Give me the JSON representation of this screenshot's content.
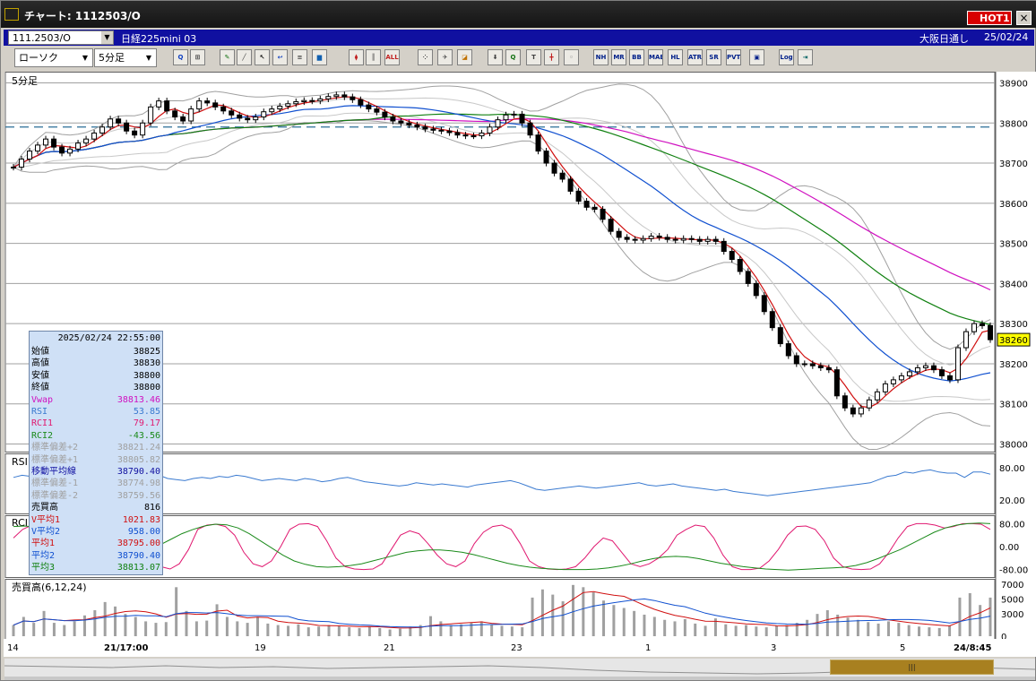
{
  "window": {
    "title": "チャート: 1112503/O",
    "hot_label": "HOT1",
    "close_label": "×"
  },
  "info": {
    "symbol": "111.2503/O",
    "symbol_name": "日経225mini 03",
    "market": "大阪日通し",
    "date": "25/02/24"
  },
  "toolbar": {
    "chart_type": "ローソク",
    "interval": "5分足",
    "tools": [
      {
        "icon": "magnifier-icon",
        "text": "Q",
        "color": "#1040c0"
      },
      {
        "icon": "split-panes-icon",
        "text": "⊞",
        "color": "#404040"
      },
      {
        "icon": "pencil-icon",
        "text": "✎",
        "color": "#107010"
      },
      {
        "icon": "draw-line-icon",
        "text": "╱",
        "color": "#404040"
      },
      {
        "icon": "cursor-icon",
        "text": "↖",
        "color": "#000000"
      },
      {
        "icon": "undo-icon",
        "text": "↩",
        "color": "#1040c0"
      },
      {
        "icon": "list-icon",
        "text": "≡",
        "color": "#404040"
      },
      {
        "icon": "trash-icon",
        "text": "▆",
        "color": "#1060b0"
      },
      {
        "icon": "candle-icon",
        "text": "⧫",
        "color": "#c02020"
      },
      {
        "icon": "bars-icon",
        "text": "║",
        "color": "#404040"
      },
      {
        "icon": "all-icon",
        "text": "ALL",
        "color": "#c02020"
      },
      {
        "icon": "dots-icon",
        "text": "⁘",
        "color": "#404040"
      },
      {
        "icon": "wrench-icon",
        "text": "✈",
        "color": "#404040"
      },
      {
        "icon": "color-icon",
        "text": "◪",
        "color": "#c07000"
      },
      {
        "icon": "arrow-down-icon",
        "text": "⬇",
        "color": "#404040"
      },
      {
        "icon": "zoom-icon",
        "text": "Q",
        "color": "#107010"
      },
      {
        "icon": "text-box-icon",
        "text": "T",
        "color": "#404040"
      },
      {
        "icon": "crosshair-icon",
        "text": "╋",
        "color": "#c02020"
      },
      {
        "icon": "lock-icon",
        "text": "◦",
        "color": "#808080"
      },
      {
        "icon": "indicator-nh-icon",
        "text": "NH",
        "color": "#00208a"
      },
      {
        "icon": "indicator-mr-icon",
        "text": "MR",
        "color": "#00208a"
      },
      {
        "icon": "indicator-bb-icon",
        "text": "BB",
        "color": "#00208a"
      },
      {
        "icon": "indicator-mae-icon",
        "text": "MAE",
        "color": "#00208a"
      },
      {
        "icon": "indicator-hl-icon",
        "text": "HL",
        "color": "#00208a"
      },
      {
        "icon": "indicator-atr-icon",
        "text": "ATR",
        "color": "#00208a"
      },
      {
        "icon": "indicator-sr-icon",
        "text": "SR",
        "color": "#00208a"
      },
      {
        "icon": "indicator-pvt-icon",
        "text": "PVT",
        "color": "#00208a"
      },
      {
        "icon": "frame-icon",
        "text": "▣",
        "color": "#00208a"
      },
      {
        "icon": "log-icon",
        "text": "Log",
        "color": "#00208a"
      },
      {
        "icon": "export-icon",
        "text": "⇥",
        "color": "#006060"
      }
    ]
  },
  "chart": {
    "panel_label": "5分足",
    "price_axis": [
      "38900",
      "38800",
      "38700",
      "38600",
      "38500",
      "38400",
      "38300",
      "38200",
      "38100",
      "38000"
    ],
    "last_price": "38260",
    "dashed_level": 38790,
    "rsi_label": "RSI",
    "rsi_axis": [
      "80.00",
      "20.00"
    ],
    "rci_label": "RCI",
    "rci_axis": [
      "80.00",
      "0.00",
      "-80.00"
    ],
    "volume_label": "売買高(6,12,24)",
    "volume_axis": [
      "7000",
      "5000",
      "3000",
      "0"
    ],
    "time_axis": [
      "14",
      "21/17:00",
      "19",
      "21",
      "23",
      "1",
      "3",
      "5",
      "24/8:45"
    ],
    "colors": {
      "up": "#ffffff",
      "down": "#000000",
      "ma_short": "#d01010",
      "ma_mid": "#1050d0",
      "ma_long": "#108010",
      "ma_vwap": "#d010c0",
      "band": "#a0a0a0",
      "dashed": "#2a6f98",
      "rsi": "#3a7ad0",
      "rci1": "#e01870",
      "rci2": "#1a8a1a"
    }
  },
  "chart_data": {
    "type": "candlestick",
    "ylim": [
      37990,
      38910
    ],
    "close": [
      38690,
      38710,
      38730,
      38745,
      38760,
      38740,
      38725,
      38735,
      38750,
      38760,
      38775,
      38790,
      38810,
      38800,
      38780,
      38770,
      38800,
      38840,
      38855,
      38830,
      38815,
      38805,
      38835,
      38855,
      38850,
      38840,
      38830,
      38820,
      38812,
      38808,
      38815,
      38828,
      38835,
      38842,
      38848,
      38853,
      38856,
      38855,
      38860,
      38866,
      38870,
      38865,
      38858,
      38845,
      38835,
      38827,
      38815,
      38805,
      38800,
      38795,
      38790,
      38785,
      38782,
      38780,
      38776,
      38770,
      38768,
      38768,
      38775,
      38790,
      38808,
      38820,
      38822,
      38800,
      38770,
      38730,
      38700,
      38675,
      38660,
      38630,
      38605,
      38590,
      38585,
      38560,
      38530,
      38515,
      38510,
      38508,
      38512,
      38518,
      38515,
      38510,
      38508,
      38512,
      38510,
      38505,
      38510,
      38505,
      38480,
      38460,
      38430,
      38400,
      38370,
      38330,
      38290,
      38250,
      38220,
      38200,
      38200,
      38195,
      38190,
      38185,
      38120,
      38090,
      38075,
      38090,
      38110,
      38130,
      38150,
      38160,
      38170,
      38180,
      38190,
      38195,
      38185,
      38170,
      38160,
      38240,
      38280,
      38300,
      38295,
      38260
    ],
    "rsi": [
      62,
      66,
      64,
      70,
      68,
      60,
      62,
      58,
      60,
      64,
      66,
      62,
      64,
      66,
      62,
      68,
      70,
      66,
      60,
      58,
      56,
      60,
      62,
      60,
      64,
      62,
      66,
      64,
      60,
      56,
      58,
      60,
      58,
      56,
      60,
      58,
      54,
      56,
      60,
      62,
      58,
      54,
      52,
      50,
      48,
      46,
      48,
      52,
      50,
      48,
      50,
      48,
      46,
      44,
      48,
      50,
      52,
      54,
      56,
      52,
      46,
      40,
      38,
      40,
      42,
      44,
      46,
      44,
      42,
      44,
      46,
      48,
      50,
      52,
      48,
      46,
      48,
      50,
      46,
      44,
      42,
      40,
      38,
      40,
      36,
      34,
      32,
      30,
      28,
      30,
      32,
      34,
      36,
      38,
      40,
      42,
      44,
      46,
      48,
      50,
      52,
      58,
      64,
      66,
      72,
      70,
      74,
      76,
      72,
      70,
      70,
      62,
      72,
      72,
      68
    ],
    "rci1": [
      30,
      60,
      75,
      80,
      50,
      0,
      -60,
      -75,
      -70,
      -40,
      0,
      55,
      75,
      70,
      40,
      -30,
      -70,
      -78,
      -60,
      -10,
      60,
      75,
      78,
      70,
      40,
      -20,
      -60,
      -70,
      -50,
      0,
      60,
      78,
      80,
      70,
      20,
      -40,
      -70,
      -78,
      -80,
      -78,
      -60,
      -10,
      40,
      55,
      45,
      10,
      -30,
      -60,
      -70,
      -50,
      10,
      50,
      70,
      75,
      60,
      10,
      -50,
      -70,
      -78,
      -80,
      -78,
      -70,
      -40,
      0,
      30,
      20,
      -20,
      -60,
      -70,
      -60,
      -40,
      -10,
      40,
      60,
      75,
      70,
      30,
      -30,
      -70,
      -80,
      -80,
      -75,
      -50,
      -10,
      40,
      70,
      72,
      60,
      20,
      -40,
      -70,
      -78,
      -80,
      -78,
      -60,
      -20,
      30,
      70,
      80,
      80,
      75,
      65,
      70,
      80,
      80,
      78,
      60
    ],
    "rci2": [
      70,
      72,
      68,
      60,
      45,
      25,
      10,
      -5,
      -20,
      -30,
      -35,
      -30,
      -15,
      5,
      25,
      45,
      60,
      72,
      78,
      76,
      65,
      45,
      20,
      -5,
      -30,
      -50,
      -62,
      -70,
      -72,
      -70,
      -66,
      -60,
      -50,
      -40,
      -30,
      -20,
      -15,
      -12,
      -12,
      -15,
      -20,
      -28,
      -38,
      -48,
      -58,
      -66,
      -72,
      -76,
      -78,
      -80,
      -80,
      -80,
      -78,
      -74,
      -68,
      -60,
      -50,
      -42,
      -36,
      -34,
      -36,
      -42,
      -50,
      -58,
      -64,
      -70,
      -74,
      -78,
      -80,
      -82,
      -80,
      -78,
      -76,
      -74,
      -72,
      -66,
      -56,
      -42,
      -26,
      -10,
      10,
      30,
      50,
      65,
      75,
      80,
      82,
      80
    ],
    "volume": [
      1500,
      2600,
      1800,
      3400,
      1800,
      1500,
      2000,
      2800,
      3500,
      4600,
      4000,
      3000,
      2600,
      2000,
      1800,
      1900,
      6600,
      3400,
      2000,
      2100,
      4300,
      2600,
      2000,
      1800,
      2600,
      1700,
      1500,
      1400,
      1600,
      1200,
      1300,
      1500,
      1400,
      1200,
      1100,
      1300,
      1100,
      900,
      1000,
      1300,
      1500,
      2700,
      2000,
      1500,
      1600,
      1800,
      2000,
      1500,
      1400,
      1300,
      1200,
      5200,
      6300,
      5600,
      4700,
      6900,
      6600,
      5900,
      4800,
      4200,
      3800,
      3400,
      2900,
      2600,
      2200,
      2000,
      2300,
      1700,
      1400,
      2400,
      1600,
      1400,
      1500,
      1300,
      1200,
      1400,
      1500,
      1800,
      2200,
      3000,
      3500,
      2900,
      2500,
      2200,
      1900,
      1700,
      2000,
      1800,
      1500,
      1300,
      1200,
      1100,
      1400,
      5200,
      5800,
      4200,
      5200
    ]
  },
  "data_window": {
    "timestamp": "2025/02/24 22:55:00",
    "rows": [
      {
        "label": "始値",
        "value": "38825",
        "color": "#000000"
      },
      {
        "label": "高値",
        "value": "38830",
        "color": "#000000"
      },
      {
        "label": "安値",
        "value": "38800",
        "color": "#000000"
      },
      {
        "label": "終値",
        "value": "38800",
        "color": "#000000"
      },
      {
        "label": "Vwap",
        "value": "38813.46",
        "color": "#d010c0"
      },
      {
        "label": "RSI",
        "value": "53.85",
        "color": "#3a7ad0"
      },
      {
        "label": "RCI1",
        "value": "79.17",
        "color": "#e01870"
      },
      {
        "label": "RCI2",
        "value": "-43.56",
        "color": "#1a8a1a"
      },
      {
        "label": "標準偏差+2",
        "value": "38821.24",
        "color": "#a0a0a0"
      },
      {
        "label": "標準偏差+1",
        "value": "38805.82",
        "color": "#a0a0a0"
      },
      {
        "label": "移動平均線",
        "value": "38790.40",
        "color": "#1010a0"
      },
      {
        "label": "標準偏差-1",
        "value": "38774.98",
        "color": "#a0a0a0"
      },
      {
        "label": "標準偏差-2",
        "value": "38759.56",
        "color": "#a0a0a0"
      },
      {
        "label": "売買高",
        "value": "816",
        "color": "#000000"
      },
      {
        "label": "V平均1",
        "value": "1021.83",
        "color": "#d01010"
      },
      {
        "label": "V平均2",
        "value": "958.00",
        "color": "#1050d0"
      },
      {
        "label": "平均1",
        "value": "38795.00",
        "color": "#d01010"
      },
      {
        "label": "平均2",
        "value": "38790.40",
        "color": "#1050d0"
      },
      {
        "label": "平均3",
        "value": "38813.07",
        "color": "#108010"
      }
    ]
  }
}
